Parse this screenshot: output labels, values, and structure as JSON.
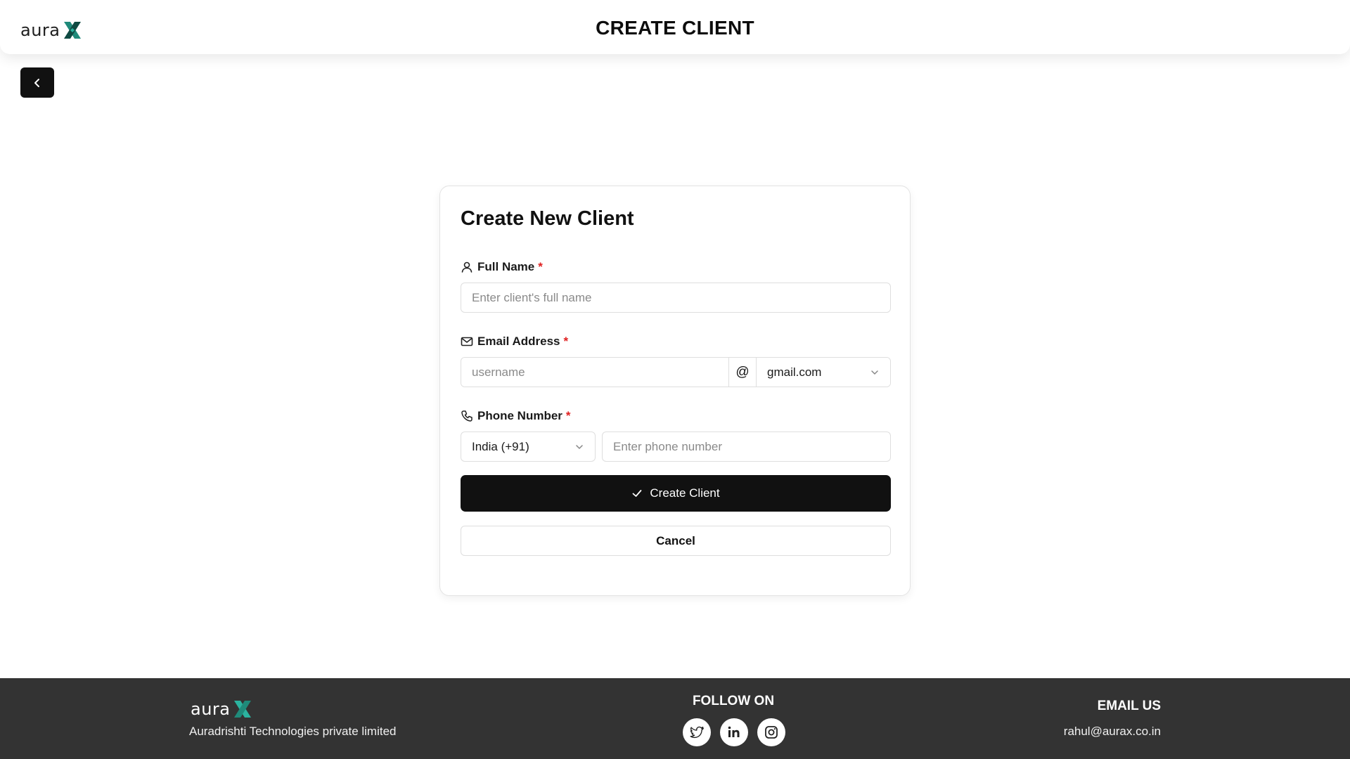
{
  "brand": {
    "logo_text": "aura",
    "logo_mark": "X",
    "accent_color": "#1f8a7a"
  },
  "header": {
    "title": "CREATE CLIENT"
  },
  "back_button": {
    "icon": "chevron-left-icon"
  },
  "form": {
    "title": "Create New Client",
    "full_name": {
      "label": "Full Name",
      "required_marker": "*",
      "placeholder": "Enter client's full name",
      "value": ""
    },
    "email": {
      "label": "Email Address",
      "required_marker": "*",
      "username_placeholder": "username",
      "username_value": "",
      "at_symbol": "@",
      "domain_selected": "gmail.com"
    },
    "phone": {
      "label": "Phone Number",
      "required_marker": "*",
      "country_selected": "India (+91)",
      "placeholder": "Enter phone number",
      "value": ""
    },
    "submit_label": "Create Client",
    "cancel_label": "Cancel"
  },
  "footer": {
    "company_name": "Auradrishti Technologies private limited",
    "follow_heading": "FOLLOW ON",
    "social_icons": [
      "twitter-icon",
      "linkedin-icon",
      "instagram-icon"
    ],
    "email_heading": "EMAIL US",
    "email": "rahul@aurax.co.in"
  },
  "colors": {
    "primary_button": "#111111",
    "required": "#e02020",
    "footer_bg": "#333333"
  }
}
